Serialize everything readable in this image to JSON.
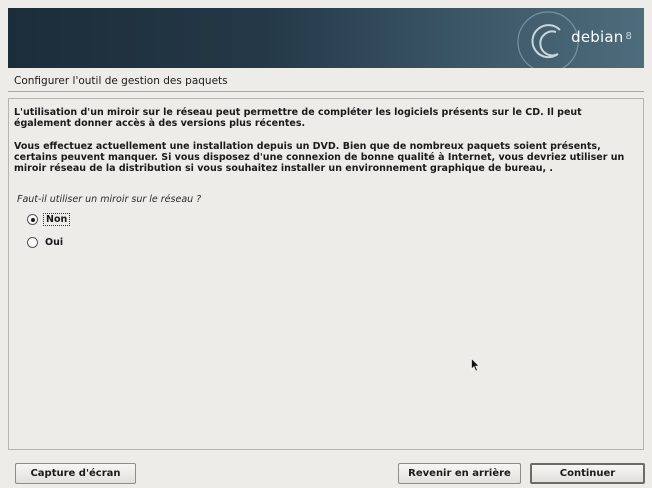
{
  "banner": {
    "logo_text": "debian",
    "logo_version": "8",
    "colors": {
      "bg_dark": "#1c2d3a",
      "bg_light": "#4e6c7c"
    }
  },
  "page": {
    "title": "Configurer l'outil de gestion des paquets"
  },
  "content": {
    "paragraph1": "L'utilisation d'un miroir sur le réseau peut permettre de compléter les logiciels présents sur le CD. Il peut également donner accès à des versions plus récentes.",
    "paragraph2": "Vous effectuez actuellement une installation depuis un DVD. Bien que de nombreux paquets soient présents, certains peuvent manquer. Si vous disposez d'une connexion de bonne qualité à Internet, vous devriez utiliser un miroir réseau de la distribution si vous souhaitez installer un environnement graphique de bureau, .",
    "question": "Faut-il utiliser un miroir sur le réseau ?",
    "options": [
      {
        "label": "Non",
        "selected": true
      },
      {
        "label": "Oui",
        "selected": false
      }
    ]
  },
  "buttons": {
    "screenshot": "Capture d'écran",
    "back": "Revenir en arrière",
    "continue": "Continuer"
  }
}
